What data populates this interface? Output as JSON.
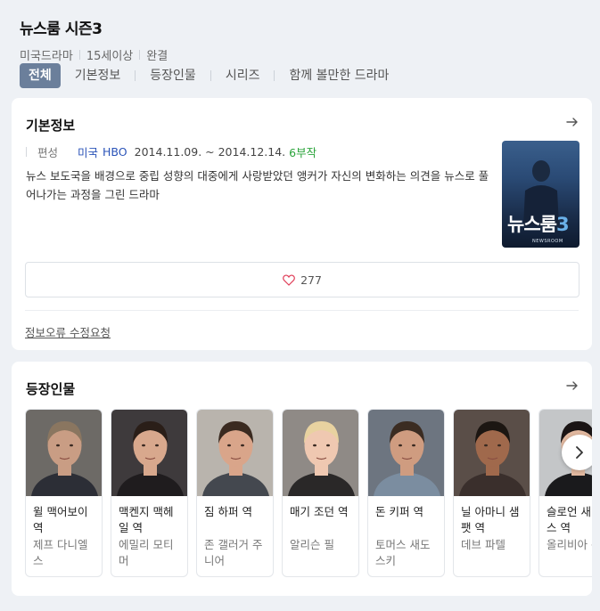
{
  "header": {
    "title": "뉴스룸 시즌3",
    "meta": [
      "미국드라마",
      "15세이상",
      "완결"
    ]
  },
  "tabs": [
    {
      "label": "전체",
      "active": true
    },
    {
      "label": "기본정보",
      "active": false
    },
    {
      "label": "등장인물",
      "active": false
    },
    {
      "label": "시리즈",
      "active": false
    },
    {
      "label": "함께 볼만한 드라마",
      "active": false
    }
  ],
  "basic_info": {
    "title": "기본정보",
    "label": "편성",
    "country": "미국",
    "network": "HBO",
    "dates": "2014.11.09. ~ 2014.12.14.",
    "episodes": "6부작",
    "description": "뉴스 보도국을 배경으로 중립 성향의 대중에게 사랑받았던 앵커가 자신의 변화하는 의견을 뉴스로 풀어나가는 과정을 그린 드라마",
    "poster_title_main": "뉴스룸",
    "poster_title_num": "3",
    "poster_sub": "NEWSROOM",
    "likes": "277",
    "report_link": "정보오류 수정요청"
  },
  "cast": {
    "title": "등장인물",
    "items": [
      {
        "role": "윌 맥어보이 역",
        "actor": "제프 다니엘스",
        "skin": "#c99d84",
        "hair": "#8a7660",
        "bg": "#6d6a66",
        "suit": "#2c2e36"
      },
      {
        "role": "맥켄지 맥헤일 역",
        "actor": "에밀리 모티머",
        "skin": "#d8a88d",
        "hair": "#2a1e18",
        "bg": "#3e3a3c",
        "suit": "#1f1c1e"
      },
      {
        "role": "짐 하퍼 역",
        "actor": "존 갤러거 주니어",
        "skin": "#d9a58a",
        "hair": "#3a2a20",
        "bg": "#b9b4ad",
        "suit": "#44484f"
      },
      {
        "role": "매기 조던 역",
        "actor": "알리슨 필",
        "skin": "#efc8b1",
        "hair": "#e8d2a0",
        "bg": "#8f8a86",
        "suit": "#2a2828"
      },
      {
        "role": "돈 키퍼 역",
        "actor": "토머스 새도스키",
        "skin": "#cf9c80",
        "hair": "#3b2c22",
        "bg": "#6d7580",
        "suit": "#7b8da0"
      },
      {
        "role": "닐 아마니 샘팻 역",
        "actor": "데브 파텔",
        "skin": "#a0694c",
        "hair": "#1c1612",
        "bg": "#5a4e48",
        "suit": "#3a2f2c"
      },
      {
        "role": "슬로언 새비스 역",
        "actor": "올리비아 문",
        "skin": "#e2b9a0",
        "hair": "#1a1414",
        "bg": "#c4c6c8",
        "suit": "#1a1a1c"
      }
    ]
  },
  "colors": {
    "active_tab": "#6b7f9b",
    "link_blue": "#2a53b8",
    "episode_green": "#2aa33a",
    "heart": "#e0405a"
  },
  "icons": {
    "arrow": "arrow-right-icon",
    "heart": "heart-outline-icon",
    "next": "chevron-right-icon"
  }
}
